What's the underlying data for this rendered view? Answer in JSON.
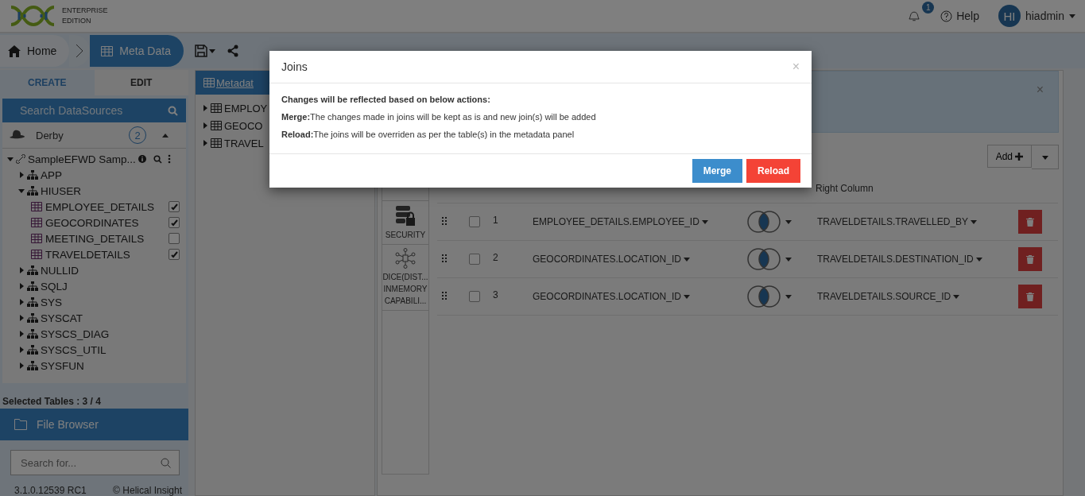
{
  "header": {
    "edition_lines": [
      "ENTERPRISE",
      "EDITION"
    ],
    "notifications": {
      "count": "1"
    },
    "help": "Help",
    "user": {
      "initials": "HI",
      "name": "hiadmin"
    }
  },
  "breadcrumb": [
    {
      "label": "Home",
      "selected": false,
      "kind": "home"
    },
    {
      "label": "Meta Data",
      "selected": true,
      "kind": "table"
    }
  ],
  "left_panel": {
    "tabs": [
      {
        "label": "CREATE",
        "selected": false
      },
      {
        "label": "EDIT",
        "selected": true
      }
    ],
    "search": {
      "placeholder": "Search DataSources"
    },
    "datasource_type": {
      "name": "Derby",
      "count": "2",
      "expanded": true
    },
    "tree": {
      "label": "SampleEFWD Samp...",
      "expanded": true,
      "children": [
        {
          "label": "APP",
          "expanded": false
        },
        {
          "label": "HIUSER",
          "expanded": true,
          "children": [
            {
              "label": "EMPLOYEE_DETAILS",
              "checked": true
            },
            {
              "label": "GEOCORDINATES",
              "checked": true
            },
            {
              "label": "MEETING_DETAILS",
              "checked": false
            },
            {
              "label": "TRAVELDETAILS",
              "checked": true
            }
          ]
        },
        {
          "label": "NULLID",
          "expanded": false
        },
        {
          "label": "SQLJ",
          "expanded": false
        },
        {
          "label": "SYS",
          "expanded": false
        },
        {
          "label": "SYSCAT",
          "expanded": false
        },
        {
          "label": "SYSCS_DIAG",
          "expanded": false
        },
        {
          "label": "SYSCS_UTIL",
          "expanded": false
        },
        {
          "label": "SYSFUN",
          "expanded": false
        }
      ]
    },
    "selected_tables": "Selected Tables : 3 / 4",
    "file_browser": "File Browser",
    "file_search": {
      "placeholder": "Search for..."
    },
    "version": "3.1.0.12539 RC1",
    "copyright": "© Helical Insight"
  },
  "middle_panel": {
    "tab": "Metadat",
    "tables": [
      "EMPLOY",
      "GEOCO",
      "TRAVEL"
    ]
  },
  "right_panel": {
    "add_button": "Add",
    "close": "×",
    "side_tabs": [
      {
        "kind": "views"
      },
      {
        "label": "SECURITY",
        "kind": "security"
      },
      {
        "label": "DICE(DIST... INMEMORY CAPABILI...",
        "kind": "dice"
      }
    ],
    "column_header": "Right Column",
    "joins": [
      {
        "number": "1",
        "left": "EMPLOYEE_DETAILS.EMPLOYEE_ID",
        "right": "TRAVELDETAILS.TRAVELLED_BY",
        "checked": false
      },
      {
        "number": "2",
        "left": "GEOCORDINATES.LOCATION_ID",
        "right": "TRAVELDETAILS.DESTINATION_ID",
        "checked": false
      },
      {
        "number": "3",
        "left": "GEOCORDINATES.LOCATION_ID",
        "right": "TRAVELDETAILS.SOURCE_ID",
        "checked": false
      }
    ]
  },
  "dialog": {
    "title": "Joins",
    "close": "×",
    "intro": "Changes will be reflected based on below actions:",
    "lines": [
      "**Merge:**The changes made in joins will be kept as is and new join(s) will be added",
      "**Reload:**The joins will be overriden as per the table(s) in the metadata panel"
    ],
    "buttons": [
      {
        "label": "Merge",
        "kind": "primary"
      },
      {
        "label": "Reload",
        "kind": "danger"
      }
    ]
  }
}
